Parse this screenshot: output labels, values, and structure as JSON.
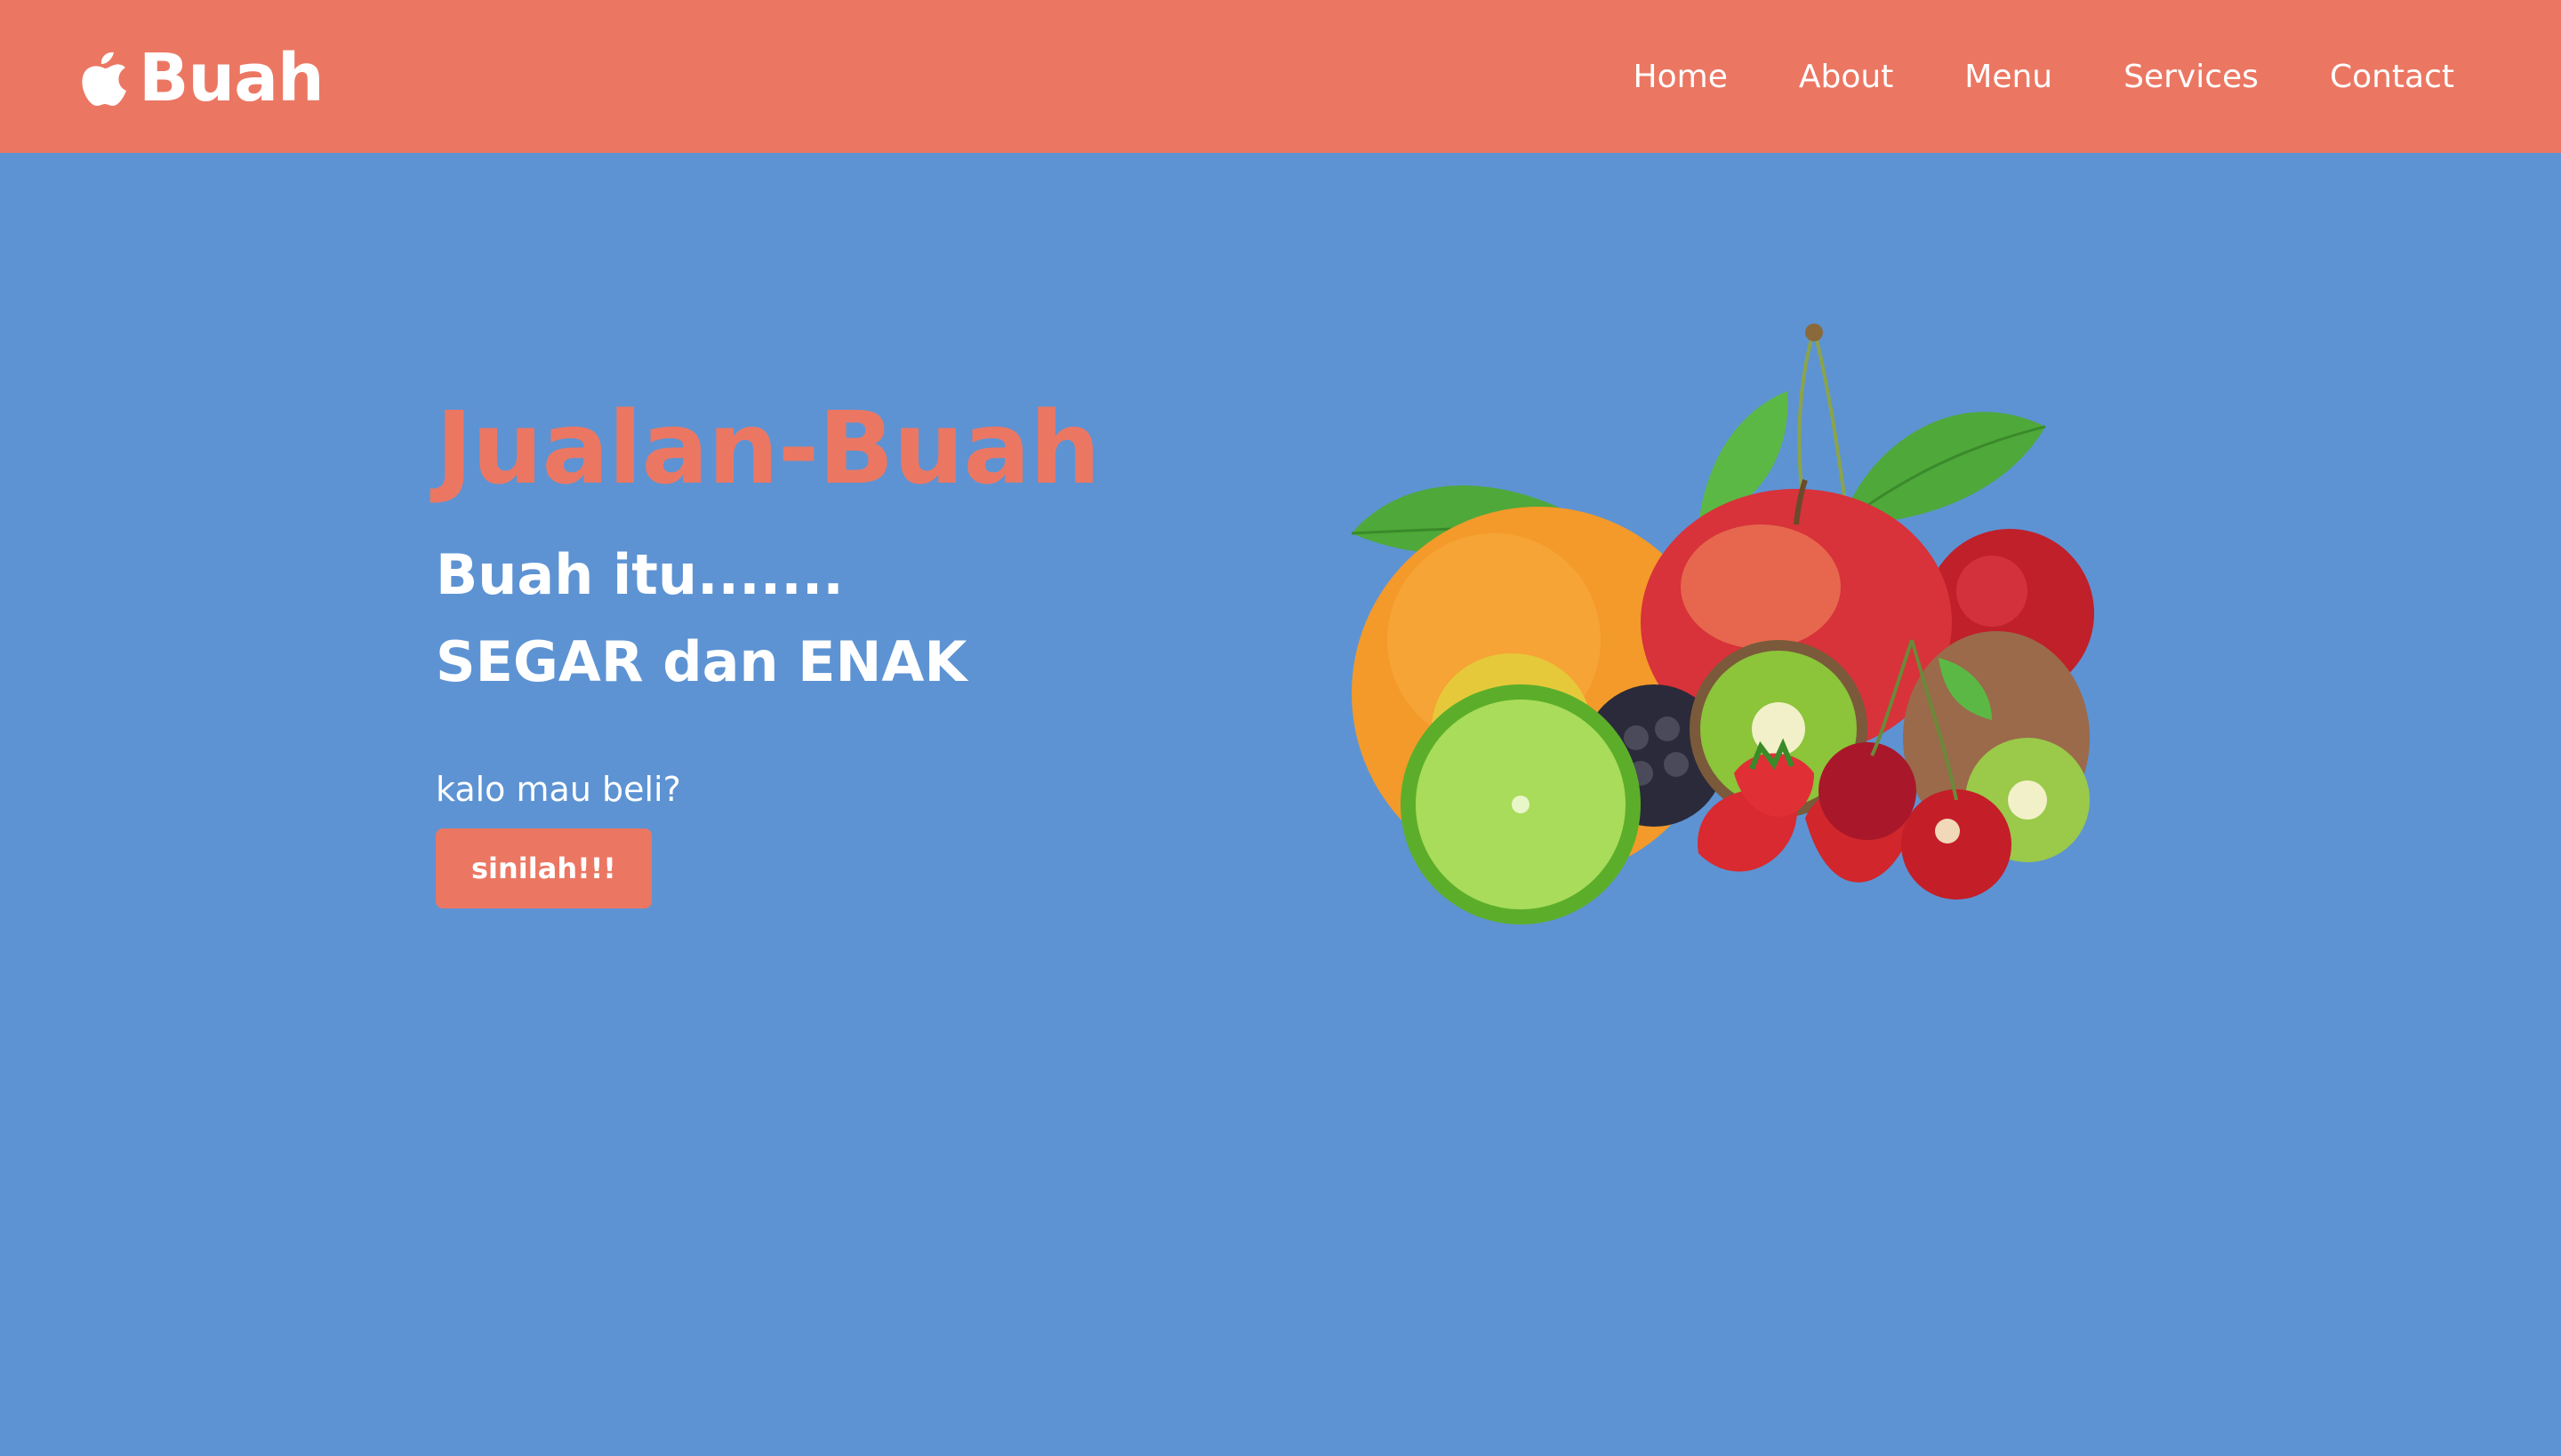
{
  "brand": {
    "icon": "apple-icon",
    "name": "Buah"
  },
  "nav": {
    "items": [
      {
        "label": "Home"
      },
      {
        "label": "About"
      },
      {
        "label": "Menu"
      },
      {
        "label": "Services"
      },
      {
        "label": "Contact"
      }
    ]
  },
  "hero": {
    "title": "Jualan-Buah",
    "subtitle_line1": "Buah itu.......",
    "subtitle_line2": "SEGAR dan ENAK",
    "question": "kalo mau beli?",
    "button_label": "sinilah!!!",
    "image": "fruit-collection-image"
  },
  "colors": {
    "accent": "#eb7763",
    "background": "#5d93d3",
    "text": "#ffffff"
  }
}
